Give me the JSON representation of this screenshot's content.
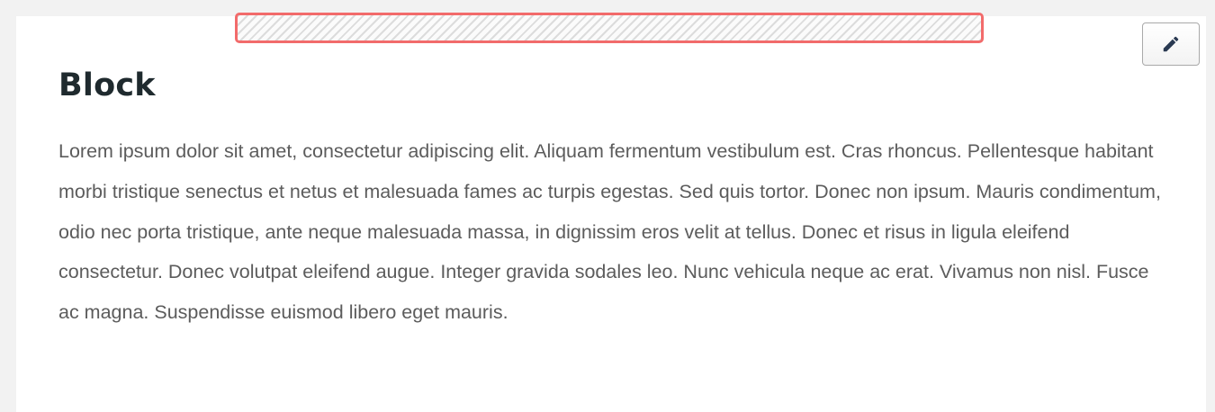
{
  "block": {
    "title": "Block",
    "body": "Lorem ipsum dolor sit amet, consectetur adipiscing elit. Aliquam fermentum vestibulum est. Cras rhoncus. Pellentesque habitant morbi tristique senectus et netus et malesuada fames ac turpis egestas. Sed quis tortor. Donec non ipsum. Mauris condimentum, odio nec porta tristique, ante neque malesuada massa, in dignissim eros velit at tellus. Donec et risus in ligula eleifend consectetur. Donec volutpat eleifend augue. Integer gravida sodales leo. Nunc vehicula neque ac erat. Vivamus non nisl. Fusce ac magna. Suspendisse euismod libero eget mauris."
  },
  "toolbar": {
    "edit_icon": "pencil-icon"
  },
  "colors": {
    "drop_zone_border": "#f26b6b",
    "title": "#1f2a2e",
    "body_text": "#5c5c5c",
    "background": "#f2f2f2"
  }
}
